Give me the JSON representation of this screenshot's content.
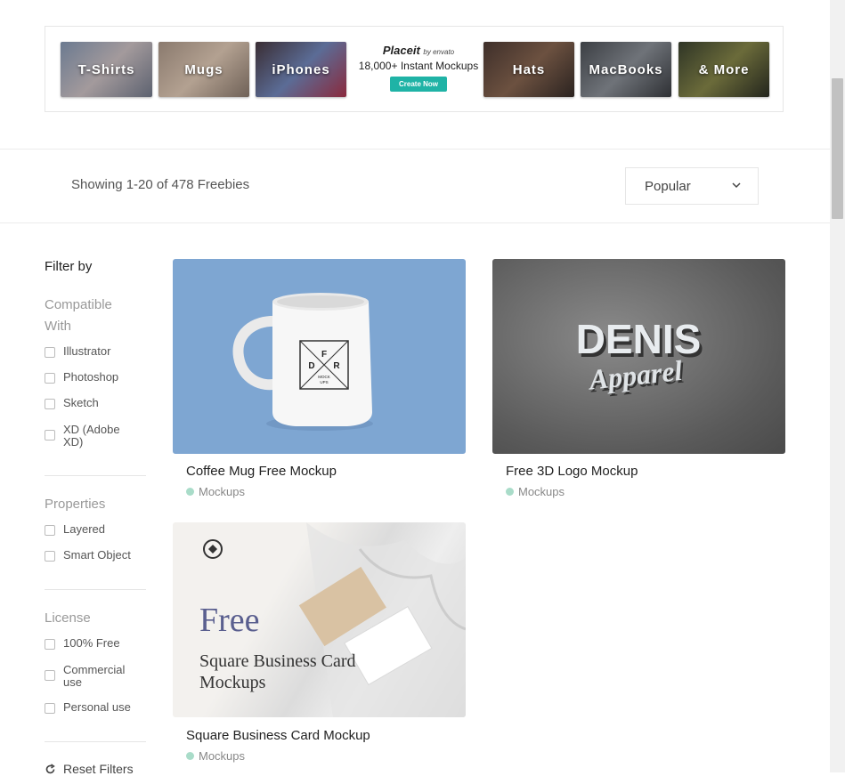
{
  "banner": {
    "tiles_left": [
      "T-Shirts",
      "Mugs",
      "iPhones"
    ],
    "tiles_right": [
      "Hats",
      "MacBooks",
      "& More"
    ],
    "placeit_logo": "Placeit",
    "placeit_by": "by envato",
    "placeit_tagline": "18,000+ Instant Mockups",
    "placeit_cta": "Create Now"
  },
  "results": {
    "showing_text": "Showing 1-20 of 478 Freebies",
    "sort_value": "Popular"
  },
  "filters": {
    "title": "Filter by",
    "groups": [
      {
        "title": "Compatible With",
        "options": [
          "Illustrator",
          "Photoshop",
          "Sketch",
          "XD (Adobe XD)"
        ]
      },
      {
        "title": "Properties",
        "options": [
          "Layered",
          "Smart Object"
        ]
      },
      {
        "title": "License",
        "options": [
          "100% Free",
          "Commercial use",
          "Personal use"
        ]
      }
    ],
    "reset_label": "Reset Filters"
  },
  "cards": [
    {
      "title": "Coffee Mug Free Mockup",
      "category": "Mockups",
      "mug_text": [
        "F",
        "D",
        "R",
        "MOCK",
        "UPS"
      ]
    },
    {
      "title": "Free 3D Logo Mockup",
      "category": "Mockups",
      "logo_line1": "DENIS",
      "logo_line2": "Apparel"
    },
    {
      "title": "Square Business Card Mockup",
      "category": "Mockups",
      "img_free": "Free",
      "img_line1": "Square Business Card",
      "img_line2": "Mockups"
    }
  ],
  "colors": {
    "accent": "#1fb3a6",
    "category_dot": "#a9dcc9",
    "mug_bg": "#7ea6d2"
  }
}
